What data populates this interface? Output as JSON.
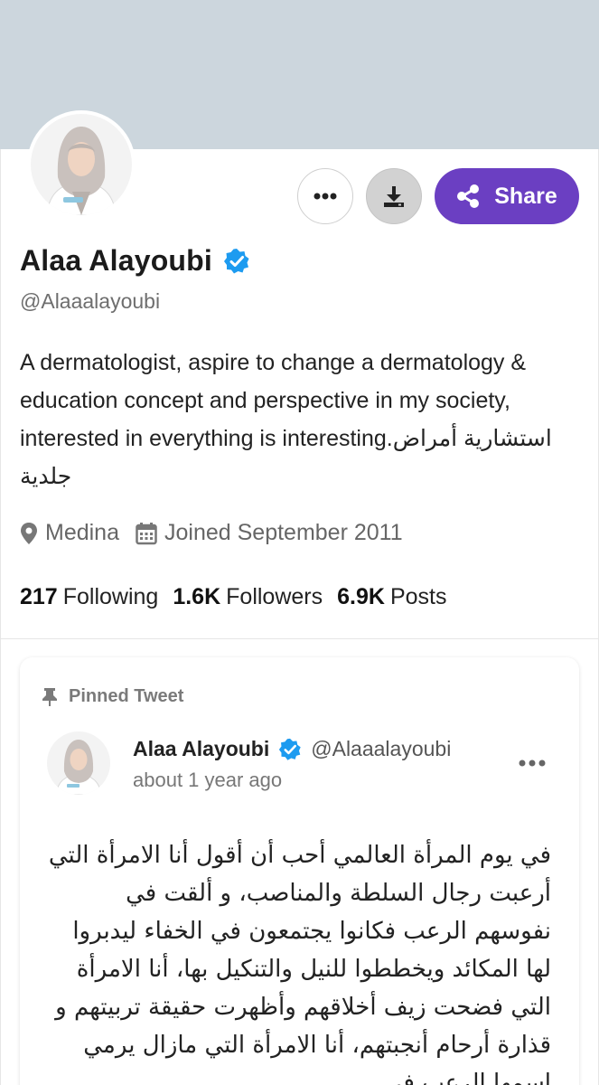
{
  "profile": {
    "name": "Alaa Alayoubi",
    "handle": "@Alaaalayoubi",
    "verified": true,
    "bio_en": "A dermatologist, aspire to change a dermatology & education concept and perspective in my society, interested in everything is interesting.",
    "bio_ar": "استشارية أمراض جلدية",
    "location": "Medina",
    "joined": "Joined September 2011"
  },
  "stats": {
    "following_count": "217",
    "following_label": "Following",
    "followers_count": "1.6K",
    "followers_label": "Followers",
    "posts_count": "6.9K",
    "posts_label": "Posts"
  },
  "actions": {
    "share_label": "Share",
    "more_icon": "more-horizontal-icon",
    "download_icon": "download-icon",
    "share_icon": "share-icon"
  },
  "pinned_tweet": {
    "label": "Pinned Tweet",
    "author_name": "Alaa Alayoubi",
    "author_handle": "@Alaaalayoubi",
    "time": "about 1 year ago",
    "text": "في يوم المرأة العالمي أحب أن أقول أنا الامرأة التي أرعبت رجال السلطة والمناصب، و ألقت في نفوسهم الرعب فكانوا يجتمعون في الخفاء ليدبروا لها المكائد ويخططوا للنيل والتنكيل بها، أنا الامرأة التي فضحت زيف أخلاقهم وأظهرت حقيقة تربيتهم و قذارة أرحام أنجبتهم، أنا الامرأة التي مازال يرمي اسمها الرعب في"
  },
  "colors": {
    "banner": "#ccd6dd",
    "accent": "#6b3fc2",
    "verified": "#1d9bf0"
  }
}
